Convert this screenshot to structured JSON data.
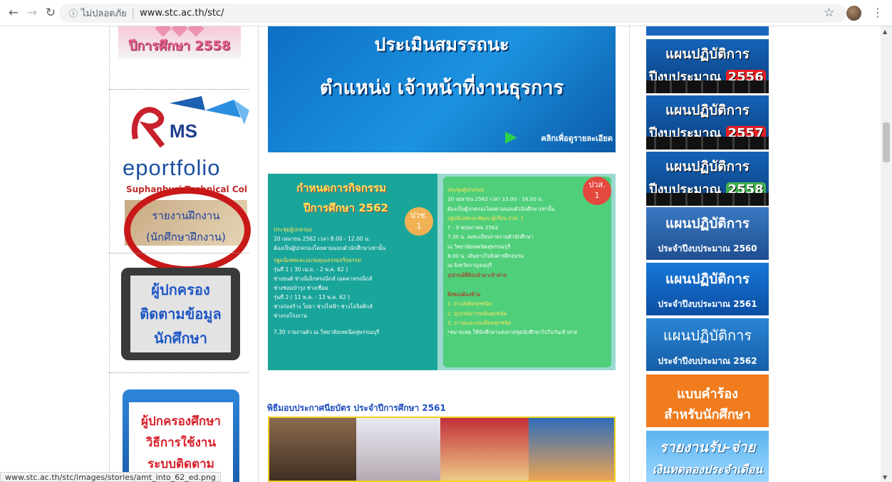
{
  "browser": {
    "security_label": "ไม่ปลอดภัย",
    "url": "www.stc.ac.th/stc/",
    "status_url": "www.stc.ac.th/stc/images/stories/amt_into_62_ed.png"
  },
  "left": {
    "year_banner": "ปีการศึกษา 2558",
    "rms_label": "MS",
    "eportfolio": "eportfolio",
    "college": "Suphanburi Technical College",
    "internship_report": "รายงานฝึกงาน",
    "internship_sub": "(นักศึกษาฝึกงาน)",
    "parent_track": [
      "ผู้ปกครอง",
      "ติดตามข้อมูล",
      "นักศึกษา"
    ],
    "parent_howto": [
      "ผู้ปกครองศึกษา",
      "วิธีการใช้งาน",
      "ระบบติดตาม"
    ]
  },
  "center": {
    "assessment_line1": "ประเมินสมรรถนะ",
    "assessment_line2": "ตำแหน่ง เจ้าหน้าที่งานธุรการ",
    "click_detail": "คลิกเพื่อดูรายละเอียด",
    "schedule_title": "กำหนดการกิจกรรม",
    "schedule_year": "ปีการศึกษา   2562",
    "badge_pr": "ปวช.",
    "badge_num": "1",
    "badge_ps": "ปวส.",
    "left_items": [
      "ประชุมผู้ปกครอง",
      "20 เมษายน 2562 เวลา 8.00 - 12.00 น.",
      "ต้องเป็นผู้ปกครองโดยตามมอบตัวนักศึกษาเท่านั้น",
      "ปฐมนิเทศและอบรมคุณธรรมจริยธรรม",
      "รุ่นที่ 1 ( 30 เม.ย. - 2 พ.ค. 62 )",
      "ช่างยนต์ ช่างอิเล็กทรอนิกส์ เมคคาทรอนิกส์",
      "ช่างซ่อมบำรุง ช่างเชื่อม",
      "รุ่นที่ 2 ( 11 พ.ค. - 13 พ.ค. 62 )",
      "ช่างก่อสร้าง โยธา ช่างไฟฟ้า ช่างโลจิสติกส์",
      "ช่างกลโรงงาน",
      "7.30 รายงานตัว ณ วิทยาลัยเทคนิคสุพรรณบุรี"
    ],
    "right_items": [
      "ประชุมผู้ปกครอง",
      "20 เมษายน 2562 เวลา 13.00 - 16.00 น.",
      "ต้องเป็นผู้ปกครองโดยตามมอบตัวนักศึกษาเท่านั้น",
      "ปฐมนิเทศและพัฒนาผู้เรียน ปวส. 1",
      "7 - 9 พฤษภาคม 2562",
      "7.30 น. ลงทะเบียนรายงานตัวนักศึกษา",
      "ณ วิทยาลัยเทคนิคสุพรรณบุรี",
      "8.00 น. เดินทางไปยังค่ายฝึกอบรม",
      "ณ จังหวัดกาญจนบุรี",
      "อุปกรณ์ที่ต้องนำมาเข้าค่าย",
      "สิ่งของต้องห้าม",
      "1. ยาเสพติดทุกชนิด",
      "2. อุปกรณ์การพนันทุกชนิด",
      "3. อาวุธและของมีคมทุกชนิด",
      "*หมายเหตุ ให้นักศึกษาแต่งกายชุดนักศึกษาไปในวันเข้าค่าย"
    ],
    "ceremony_title": "พิธีมอบประกาศนียบัตร ประจำปีการศึกษา 2561"
  },
  "right": {
    "plan_banners": [
      {
        "l1": "แผนปฏิบัติการ",
        "l2": "ปีงบประมาณ",
        "year": "2556"
      },
      {
        "l1": "แผนปฏิบัติการ",
        "l2": "ปีงบประมาณ",
        "year": "2557"
      },
      {
        "l1": "แผนปฏิบัติการ",
        "l2": "ปีงบประมาณ",
        "year": "2558"
      }
    ],
    "plan_2560": {
      "l1": "แผนปฏิบัติการ",
      "l2": "ประจำปีงบประมาณ 2560"
    },
    "plan_2561": {
      "l1": "แผนปฏิบัติการ",
      "l2": "ประจำปีงบประมาณ 2561"
    },
    "plan_2562": {
      "l1": "แผนปฏิบัติการ",
      "l2": "ประจำปีงบประมาณ 2562"
    },
    "form": {
      "l1": "แบบคำร้อง",
      "l2": "สำหรับนักศึกษา"
    },
    "finance": {
      "l1": "รายงานรับ-จ่าย",
      "l2": "เงินทดลองประจำเดือน"
    }
  }
}
